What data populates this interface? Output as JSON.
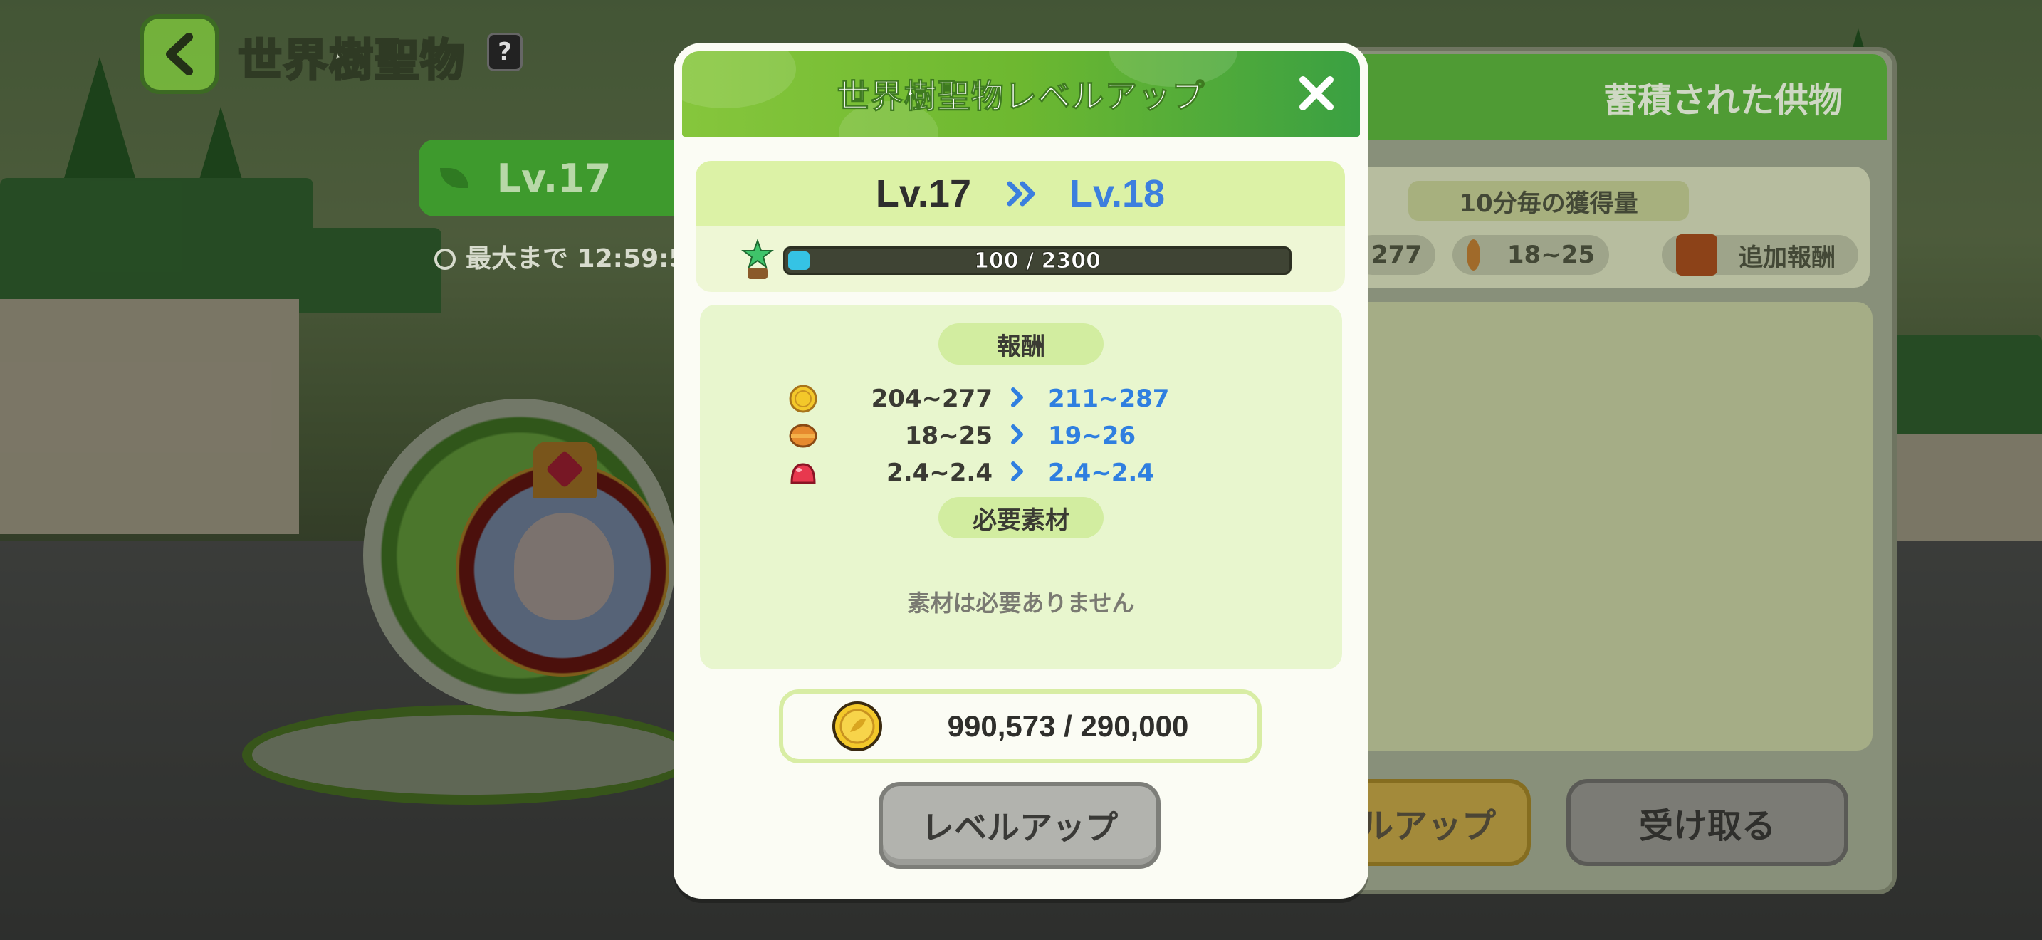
{
  "header": {
    "title": "世界樹聖物",
    "help_symbol": "?"
  },
  "background": {
    "level_label": "Lv.17",
    "timer_text": "最大まで 12:59:5"
  },
  "side_panel": {
    "title": "蓄積された供物",
    "subtitle": "10分毎の獲得量",
    "chips": [
      "277",
      "18~25",
      "追加報酬"
    ],
    "levelup_button": "ルアップ",
    "receive_button": "受け取る"
  },
  "modal": {
    "title": "世界樹聖物レベルアップ",
    "current_level": "Lv.17",
    "next_level": "Lv.18",
    "exp_text": "100 / 2300",
    "exp_progress": 0.0435,
    "rewards_label": "報酬",
    "rewards": [
      {
        "icon": "gold-coin-icon",
        "current": "204~277",
        "next": "211~287"
      },
      {
        "icon": "food-icon",
        "current": "18~25",
        "next": "19~26"
      },
      {
        "icon": "jelly-icon",
        "current": "2.4~2.4",
        "next": "2.4~2.4"
      }
    ],
    "materials_label": "必要素材",
    "materials_none": "素材は必要ありません",
    "cost_text": "990,573 / 290,000",
    "levelup_button": "レベルアップ"
  },
  "colors": {
    "accent_green": "#6db830",
    "next_value_blue": "#2f7fe0",
    "exp_fill": "#35c3e5"
  }
}
